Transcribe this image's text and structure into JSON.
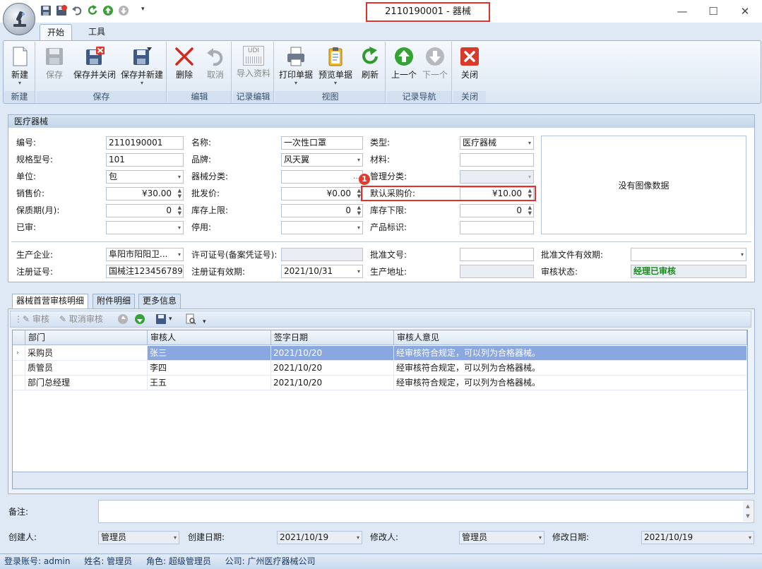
{
  "window": {
    "title": "2110190001 - 器械",
    "minimize": "—",
    "maximize": "☐",
    "close": "✕"
  },
  "ribbon": {
    "tabs": [
      "开始",
      "工具"
    ],
    "groups": {
      "new": {
        "label": "新建",
        "buttons": [
          "新建"
        ]
      },
      "save": {
        "label": "保存",
        "buttons": [
          "保存",
          "保存并关闭",
          "保存并新建"
        ]
      },
      "edit": {
        "label": "编辑",
        "buttons": [
          "删除",
          "取消"
        ]
      },
      "record_edit": {
        "label": "记录编辑",
        "buttons": [
          "导入资料"
        ]
      },
      "view": {
        "label": "视图",
        "buttons": [
          "打印单据",
          "预览单据",
          "刷新"
        ]
      },
      "nav": {
        "label": "记录导航",
        "buttons": [
          "上一个",
          "下一个"
        ]
      },
      "close": {
        "label": "关闭",
        "buttons": [
          "关闭"
        ]
      }
    },
    "udi_text": "UDI"
  },
  "form": {
    "section_title": "医疗器械",
    "code": {
      "label": "编号:",
      "value": "2110190001"
    },
    "name": {
      "label": "名称:",
      "value": "一次性口罩"
    },
    "type": {
      "label": "类型:",
      "value": "医疗器械"
    },
    "spec": {
      "label": "规格型号:",
      "value": "101"
    },
    "brand": {
      "label": "品牌:",
      "value": "风天翼"
    },
    "material": {
      "label": "材料:",
      "value": ""
    },
    "unit": {
      "label": "单位:",
      "value": "包"
    },
    "category": {
      "label": "器械分类:",
      "value": ""
    },
    "mgmt_category": {
      "label": "管理分类:",
      "value": ""
    },
    "sale_price": {
      "label": "销售价:",
      "value": "¥30.00"
    },
    "wholesale_price": {
      "label": "批发价:",
      "value": "¥0.00"
    },
    "purchase_price": {
      "label": "默认采购价:",
      "value": "¥10.00"
    },
    "shelf_life": {
      "label": "保质期(月):",
      "value": "0"
    },
    "stock_max": {
      "label": "库存上限:",
      "value": "0"
    },
    "stock_min": {
      "label": "库存下限:",
      "value": "0"
    },
    "audited": {
      "label": "已审:",
      "value": ""
    },
    "disabled": {
      "label": "停用:",
      "value": ""
    },
    "product_id": {
      "label": "产品标识:",
      "value": ""
    },
    "image_placeholder": "没有图像数据",
    "manufacturer": {
      "label": "生产企业:",
      "value": "阜阳市阳阳卫..."
    },
    "license": {
      "label": "许可证号(备案凭证号):",
      "value": ""
    },
    "approval_no": {
      "label": "批准文号:",
      "value": ""
    },
    "approval_valid": {
      "label": "批准文件有效期:",
      "value": ""
    },
    "reg_no": {
      "label": "注册证号:",
      "value": "国械注123456789"
    },
    "reg_valid": {
      "label": "注册证有效期:",
      "value": "2021/10/31"
    },
    "address": {
      "label": "生产地址:",
      "value": ""
    },
    "audit_status": {
      "label": "审核状态:",
      "value": "经理已审核"
    },
    "badge": "1"
  },
  "detail": {
    "tabs": [
      "器械首营审核明细",
      "附件明细",
      "更多信息"
    ],
    "toolbar": {
      "audit": "审核",
      "cancel_audit": "取消审核"
    },
    "columns": [
      "部门",
      "审核人",
      "签字日期",
      "审核人意见"
    ],
    "rows": [
      [
        "采购员",
        "张三",
        "2021/10/20",
        "经审核符合规定，可以列为合格器械。"
      ],
      [
        "质管员",
        "李四",
        "2021/10/20",
        "经审核符合规定，可以列为合格器械。"
      ],
      [
        "部门总经理",
        "王五",
        "2021/10/20",
        "经审核符合规定，可以列为合格器械。"
      ]
    ]
  },
  "footer": {
    "remark_label": "备注:",
    "creator": {
      "label": "创建人:",
      "value": "管理员"
    },
    "create_date": {
      "label": "创建日期:",
      "value": "2021/10/19"
    },
    "modifier": {
      "label": "修改人:",
      "value": "管理员"
    },
    "modify_date": {
      "label": "修改日期:",
      "value": "2021/10/19"
    }
  },
  "status_bar": {
    "account": "登录账号: admin",
    "name": "姓名: 管理员",
    "role": "角色: 超级管理员",
    "company": "公司: 广州医疗器械公司"
  },
  "colors": {
    "accent": "#9db3cf",
    "highlight": "#e03030",
    "audit_status": "#1a8a1a",
    "selected_row": "#8aa7df"
  }
}
